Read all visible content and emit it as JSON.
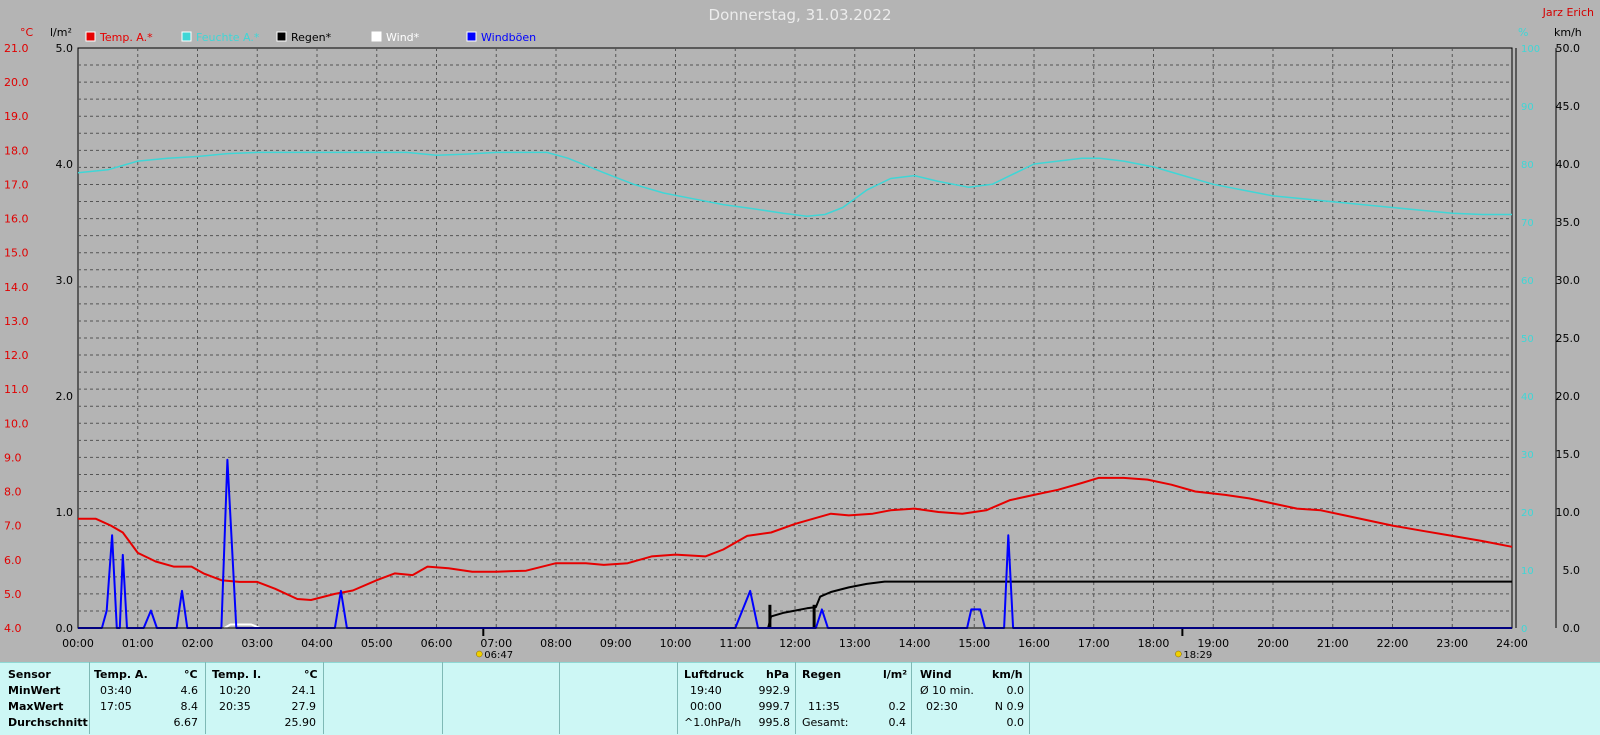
{
  "title": "Donnerstag, 31.03.2022",
  "author": "Jarz Erich",
  "colors": {
    "background": "#b4b4b4",
    "temp": "#e60000",
    "humidity": "#3fd6d6",
    "rain": "#000000",
    "wind": "#ffffff",
    "gust": "#0000ff",
    "table": "#cdf7f5"
  },
  "axes": {
    "left_unit": "°C",
    "rain_unit": "l/m²",
    "right_pct_unit": "%",
    "right_kmh_unit": "km/h"
  },
  "sun": {
    "sunrise": "06:47",
    "sunset": "18:29"
  },
  "chart_data": {
    "type": "line",
    "title": "Donnerstag, 31.03.2022",
    "x_ticks": [
      "00:00",
      "01:00",
      "02:00",
      "03:00",
      "04:00",
      "05:00",
      "06:00",
      "07:00",
      "08:00",
      "09:00",
      "10:00",
      "11:00",
      "12:00",
      "13:00",
      "14:00",
      "15:00",
      "16:00",
      "17:00",
      "18:00",
      "19:00",
      "20:00",
      "21:00",
      "22:00",
      "23:00",
      "24:00"
    ],
    "temp_axis": {
      "label": "°C",
      "min": 4.0,
      "max": 21.0,
      "ticks": [
        "4.0",
        "5.0",
        "6.0",
        "7.0",
        "8.0",
        "9.0",
        "10.0",
        "11.0",
        "12.0",
        "13.0",
        "14.0",
        "15.0",
        "16.0",
        "17.0",
        "18.0",
        "19.0",
        "20.0",
        "21.0"
      ]
    },
    "rain_axis": {
      "label": "l/m²",
      "min": 0,
      "max": 5,
      "ticks": [
        "0.0",
        "1.0",
        "2.0",
        "3.0",
        "4.0",
        "5.0"
      ]
    },
    "humidity_axis": {
      "label": "%",
      "min": 0,
      "max": 100,
      "ticks": [
        "0",
        "10",
        "20",
        "30",
        "40",
        "50",
        "60",
        "70",
        "80",
        "90",
        "100"
      ]
    },
    "wind_axis": {
      "label": "km/h",
      "min": 0,
      "max": 50,
      "ticks": [
        "0.0",
        "5.0",
        "10.0",
        "15.0",
        "20.0",
        "25.0",
        "30.0",
        "35.0",
        "40.0",
        "45.0",
        "50.0"
      ]
    },
    "grid": true,
    "legend_position": "top-left",
    "series": [
      {
        "name": "Temp. A.*",
        "axis": "temp",
        "color": "#e60000",
        "points": [
          [
            0,
            7.2
          ],
          [
            0.3,
            7.2
          ],
          [
            0.55,
            7.0
          ],
          [
            0.75,
            6.8
          ],
          [
            1.0,
            6.2
          ],
          [
            1.3,
            5.95
          ],
          [
            1.6,
            5.8
          ],
          [
            1.9,
            5.8
          ],
          [
            2.1,
            5.6
          ],
          [
            2.4,
            5.4
          ],
          [
            2.7,
            5.35
          ],
          [
            3.0,
            5.35
          ],
          [
            3.3,
            5.15
          ],
          [
            3.67,
            4.85
          ],
          [
            3.9,
            4.82
          ],
          [
            4.3,
            5.0
          ],
          [
            4.6,
            5.1
          ],
          [
            5.0,
            5.4
          ],
          [
            5.3,
            5.6
          ],
          [
            5.6,
            5.55
          ],
          [
            5.85,
            5.8
          ],
          [
            6.2,
            5.75
          ],
          [
            6.6,
            5.65
          ],
          [
            7.0,
            5.65
          ],
          [
            7.5,
            5.68
          ],
          [
            8.0,
            5.9
          ],
          [
            8.5,
            5.9
          ],
          [
            8.8,
            5.85
          ],
          [
            9.2,
            5.9
          ],
          [
            9.6,
            6.1
          ],
          [
            10.0,
            6.15
          ],
          [
            10.5,
            6.1
          ],
          [
            10.8,
            6.3
          ],
          [
            11.2,
            6.7
          ],
          [
            11.6,
            6.8
          ],
          [
            12.0,
            7.05
          ],
          [
            12.3,
            7.2
          ],
          [
            12.6,
            7.35
          ],
          [
            12.9,
            7.3
          ],
          [
            13.3,
            7.35
          ],
          [
            13.6,
            7.45
          ],
          [
            14.0,
            7.5
          ],
          [
            14.4,
            7.4
          ],
          [
            14.8,
            7.35
          ],
          [
            15.2,
            7.45
          ],
          [
            15.6,
            7.75
          ],
          [
            16.0,
            7.9
          ],
          [
            16.4,
            8.05
          ],
          [
            16.8,
            8.25
          ],
          [
            17.08,
            8.4
          ],
          [
            17.5,
            8.4
          ],
          [
            17.9,
            8.35
          ],
          [
            18.3,
            8.2
          ],
          [
            18.7,
            8.0
          ],
          [
            19.2,
            7.9
          ],
          [
            19.6,
            7.8
          ],
          [
            20.0,
            7.65
          ],
          [
            20.4,
            7.5
          ],
          [
            20.8,
            7.45
          ],
          [
            21.2,
            7.3
          ],
          [
            21.6,
            7.15
          ],
          [
            22.0,
            7.0
          ],
          [
            22.5,
            6.85
          ],
          [
            23.0,
            6.7
          ],
          [
            23.5,
            6.55
          ],
          [
            24.0,
            6.38
          ]
        ]
      },
      {
        "name": "Feuchte A.*",
        "axis": "humidity",
        "color": "#3fd6d6",
        "points": [
          [
            0,
            78.5
          ],
          [
            0.5,
            79.0
          ],
          [
            1.0,
            80.5
          ],
          [
            1.5,
            81.0
          ],
          [
            2.0,
            81.3
          ],
          [
            2.5,
            81.8
          ],
          [
            3.0,
            82.0
          ],
          [
            3.5,
            82.0
          ],
          [
            4.0,
            82.0
          ],
          [
            4.5,
            82.0
          ],
          [
            5.0,
            82.0
          ],
          [
            5.5,
            82.0
          ],
          [
            6.0,
            81.5
          ],
          [
            6.5,
            81.7
          ],
          [
            7.0,
            82.0
          ],
          [
            7.5,
            82.0
          ],
          [
            7.85,
            82.0
          ],
          [
            8.2,
            81.0
          ],
          [
            8.8,
            78.5
          ],
          [
            9.3,
            76.5
          ],
          [
            9.8,
            75.0
          ],
          [
            10.3,
            74.0
          ],
          [
            10.8,
            73.0
          ],
          [
            11.3,
            72.3
          ],
          [
            11.8,
            71.5
          ],
          [
            12.2,
            71.0
          ],
          [
            12.5,
            71.3
          ],
          [
            12.8,
            72.5
          ],
          [
            13.2,
            75.5
          ],
          [
            13.6,
            77.5
          ],
          [
            14.0,
            78.0
          ],
          [
            14.4,
            77.0
          ],
          [
            14.9,
            76.0
          ],
          [
            15.3,
            76.5
          ],
          [
            15.6,
            78.0
          ],
          [
            16.0,
            80.0
          ],
          [
            16.4,
            80.5
          ],
          [
            16.8,
            81.0
          ],
          [
            17.1,
            81.0
          ],
          [
            17.5,
            80.5
          ],
          [
            18.0,
            79.5
          ],
          [
            18.5,
            78.0
          ],
          [
            19.0,
            76.5
          ],
          [
            19.5,
            75.5
          ],
          [
            20.0,
            74.5
          ],
          [
            20.5,
            74.0
          ],
          [
            21.0,
            73.5
          ],
          [
            21.5,
            73.0
          ],
          [
            22.0,
            72.5
          ],
          [
            22.5,
            72.0
          ],
          [
            23.0,
            71.5
          ],
          [
            23.5,
            71.3
          ],
          [
            24.0,
            71.3
          ]
        ]
      },
      {
        "name": "Regen*",
        "axis": "rain",
        "color": "#000000",
        "points": [
          [
            11.55,
            0.0
          ],
          [
            11.6,
            0.1
          ],
          [
            11.8,
            0.13
          ],
          [
            12.0,
            0.15
          ],
          [
            12.2,
            0.17
          ],
          [
            12.35,
            0.18
          ],
          [
            12.42,
            0.27
          ],
          [
            12.6,
            0.31
          ],
          [
            12.9,
            0.35
          ],
          [
            13.2,
            0.38
          ],
          [
            13.5,
            0.4
          ],
          [
            14.0,
            0.4
          ],
          [
            16.0,
            0.4
          ],
          [
            18.0,
            0.4
          ],
          [
            20.0,
            0.4
          ],
          [
            22.0,
            0.4
          ],
          [
            24.0,
            0.4
          ]
        ],
        "bars": [
          [
            11.58,
            0.2
          ],
          [
            12.32,
            0.2
          ]
        ]
      },
      {
        "name": "Wind*",
        "axis": "wind",
        "color": "#ffffff",
        "points": [
          [
            2.45,
            0
          ],
          [
            2.55,
            0.3
          ],
          [
            2.9,
            0.3
          ],
          [
            3.05,
            0
          ]
        ]
      },
      {
        "name": "Windböen",
        "axis": "wind",
        "color": "#0000ff",
        "points": [
          [
            0,
            0
          ],
          [
            0.4,
            0
          ],
          [
            0.48,
            1.5
          ],
          [
            0.57,
            8.0
          ],
          [
            0.65,
            0
          ],
          [
            0.7,
            0
          ],
          [
            0.75,
            6.3
          ],
          [
            0.82,
            0
          ],
          [
            1.1,
            0
          ],
          [
            1.22,
            1.5
          ],
          [
            1.32,
            0
          ],
          [
            1.65,
            0
          ],
          [
            1.74,
            3.2
          ],
          [
            1.83,
            0
          ],
          [
            2.4,
            0
          ],
          [
            2.5,
            14.5
          ],
          [
            2.65,
            0
          ],
          [
            4.3,
            0
          ],
          [
            4.4,
            3.2
          ],
          [
            4.5,
            0
          ],
          [
            11.0,
            0
          ],
          [
            11.25,
            3.2
          ],
          [
            11.38,
            0
          ],
          [
            12.35,
            0
          ],
          [
            12.45,
            1.6
          ],
          [
            12.55,
            0
          ],
          [
            14.88,
            0
          ],
          [
            14.95,
            1.6
          ],
          [
            15.1,
            1.6
          ],
          [
            15.18,
            0
          ],
          [
            15.5,
            0
          ],
          [
            15.57,
            8.0
          ],
          [
            15.65,
            0
          ],
          [
            24.0,
            0
          ]
        ]
      }
    ]
  },
  "table": {
    "sensor": {
      "header": "Sensor",
      "min": "MinWert",
      "max": "MaxWert",
      "avg": "Durchschnitt"
    },
    "temp_a": {
      "header": "Temp. A.",
      "unit": "°C",
      "min_time": "03:40",
      "min_val": "4.6",
      "max_time": "17:05",
      "max_val": "8.4",
      "avg": "6.67"
    },
    "temp_i": {
      "header": "Temp. I.",
      "unit": "°C",
      "min_time": "10:20",
      "min_val": "24.1",
      "max_time": "20:35",
      "max_val": "27.9",
      "avg": "25.90"
    },
    "pressure": {
      "header": "Luftdruck",
      "unit": "hPa",
      "min_time": "19:40",
      "min_val": "992.9",
      "max_time": "00:00",
      "max_val": "999.7",
      "trend_label": "^1.0hPa/h",
      "avg": "995.8"
    },
    "rain": {
      "header": "Regen",
      "unit": "l/m²",
      "max_time": "11:35",
      "max_val": "0.2",
      "total_label": "Gesamt:",
      "total": "0.4"
    },
    "wind": {
      "header": "Wind",
      "unit": "km/h",
      "avg_label": "Ø 10 min.",
      "avg_val": "0.0",
      "max_time": "02:30",
      "max_val": "N 0.9",
      "day_avg": "0.0"
    }
  }
}
